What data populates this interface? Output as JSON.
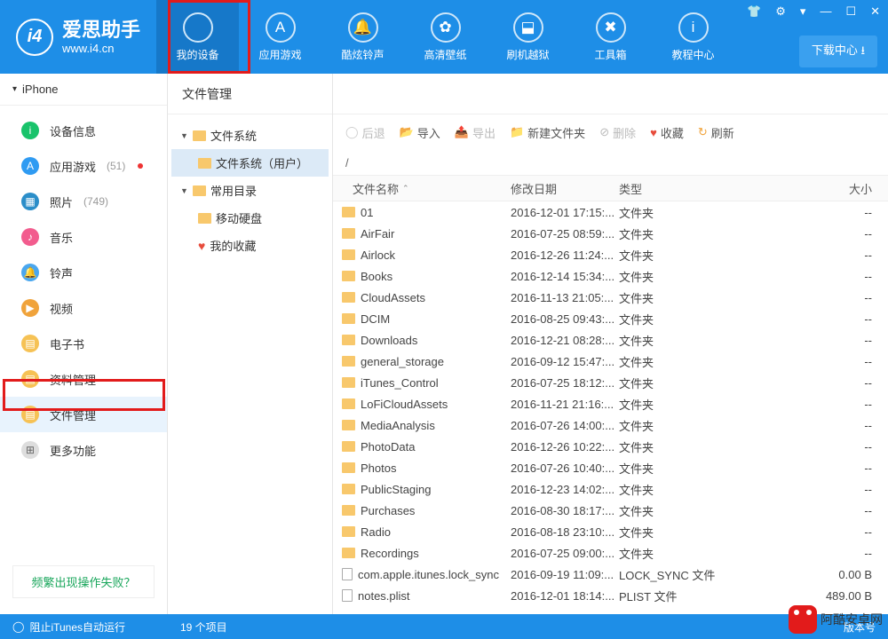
{
  "brand": {
    "title": "爱思助手",
    "url": "www.i4.cn",
    "logo_text": "i4"
  },
  "nav": [
    {
      "label": "我的设备",
      "icon": "apple-icon",
      "glyph": ""
    },
    {
      "label": "应用游戏",
      "icon": "apps-icon",
      "glyph": "A"
    },
    {
      "label": "酷炫铃声",
      "icon": "bell-icon",
      "glyph": "🔔"
    },
    {
      "label": "高清壁纸",
      "icon": "flower-icon",
      "glyph": "✿"
    },
    {
      "label": "刷机越狱",
      "icon": "box-icon",
      "glyph": "⬓"
    },
    {
      "label": "工具箱",
      "icon": "tools-icon",
      "glyph": "✖"
    },
    {
      "label": "教程中心",
      "icon": "info-icon",
      "glyph": "i"
    }
  ],
  "download_center": "下载中心 ⭳",
  "window_controls": [
    "👕",
    "⚙",
    "▾",
    "—",
    "☐",
    "✕"
  ],
  "device_name": "iPhone",
  "sidebar": [
    {
      "label": "设备信息",
      "count": "",
      "color": "ico-green",
      "glyph": "i"
    },
    {
      "label": "应用游戏",
      "count": "(51)",
      "dot": true,
      "color": "ico-blue",
      "glyph": "A"
    },
    {
      "label": "照片",
      "count": "(749)",
      "color": "ico-teal",
      "glyph": "▦"
    },
    {
      "label": "音乐",
      "count": "",
      "color": "ico-pink",
      "glyph": "♪"
    },
    {
      "label": "铃声",
      "count": "",
      "color": "ico-lblue",
      "glyph": "🔔"
    },
    {
      "label": "视频",
      "count": "",
      "color": "ico-orange",
      "glyph": "▶"
    },
    {
      "label": "电子书",
      "count": "",
      "color": "ico-yel",
      "glyph": "▤"
    },
    {
      "label": "资料管理",
      "count": "",
      "color": "ico-yel",
      "glyph": "▤"
    },
    {
      "label": "文件管理",
      "count": "",
      "color": "ico-yel2",
      "glyph": "▤",
      "selected": true
    },
    {
      "label": "更多功能",
      "count": "",
      "color": "",
      "glyph": "⊞"
    }
  ],
  "sidebar_help": "频繁出现操作失败？",
  "tab_label": "文件管理",
  "toolbar": {
    "back": "后退",
    "import": "导入",
    "export": "导出",
    "new_folder": "新建文件夹",
    "delete": "删除",
    "favorite": "收藏",
    "refresh": "刷新"
  },
  "tree": {
    "root1": "文件系统",
    "root1_child": "文件系统（用户）",
    "root2": "常用目录",
    "root2_child1": "移动硬盘",
    "root2_child2": "我的收藏"
  },
  "path": "/",
  "columns": {
    "name": "文件名称",
    "date": "修改日期",
    "type": "类型",
    "size": "大小"
  },
  "files": [
    {
      "name": "01",
      "date": "2016-12-01 17:15:...",
      "type": "文件夹",
      "size": "--",
      "kind": "folder"
    },
    {
      "name": "AirFair",
      "date": "2016-07-25 08:59:...",
      "type": "文件夹",
      "size": "--",
      "kind": "folder"
    },
    {
      "name": "Airlock",
      "date": "2016-12-26 11:24:...",
      "type": "文件夹",
      "size": "--",
      "kind": "folder"
    },
    {
      "name": "Books",
      "date": "2016-12-14 15:34:...",
      "type": "文件夹",
      "size": "--",
      "kind": "folder"
    },
    {
      "name": "CloudAssets",
      "date": "2016-11-13 21:05:...",
      "type": "文件夹",
      "size": "--",
      "kind": "folder"
    },
    {
      "name": "DCIM",
      "date": "2016-08-25 09:43:...",
      "type": "文件夹",
      "size": "--",
      "kind": "folder"
    },
    {
      "name": "Downloads",
      "date": "2016-12-21 08:28:...",
      "type": "文件夹",
      "size": "--",
      "kind": "folder"
    },
    {
      "name": "general_storage",
      "date": "2016-09-12 15:47:...",
      "type": "文件夹",
      "size": "--",
      "kind": "folder"
    },
    {
      "name": "iTunes_Control",
      "date": "2016-07-25 18:12:...",
      "type": "文件夹",
      "size": "--",
      "kind": "folder"
    },
    {
      "name": "LoFiCloudAssets",
      "date": "2016-11-21 21:16:...",
      "type": "文件夹",
      "size": "--",
      "kind": "folder"
    },
    {
      "name": "MediaAnalysis",
      "date": "2016-07-26 14:00:...",
      "type": "文件夹",
      "size": "--",
      "kind": "folder"
    },
    {
      "name": "PhotoData",
      "date": "2016-12-26 10:22:...",
      "type": "文件夹",
      "size": "--",
      "kind": "folder"
    },
    {
      "name": "Photos",
      "date": "2016-07-26 10:40:...",
      "type": "文件夹",
      "size": "--",
      "kind": "folder"
    },
    {
      "name": "PublicStaging",
      "date": "2016-12-23 14:02:...",
      "type": "文件夹",
      "size": "--",
      "kind": "folder"
    },
    {
      "name": "Purchases",
      "date": "2016-08-30 18:17:...",
      "type": "文件夹",
      "size": "--",
      "kind": "folder"
    },
    {
      "name": "Radio",
      "date": "2016-08-18 23:10:...",
      "type": "文件夹",
      "size": "--",
      "kind": "folder"
    },
    {
      "name": "Recordings",
      "date": "2016-07-25 09:00:...",
      "type": "文件夹",
      "size": "--",
      "kind": "folder"
    },
    {
      "name": "com.apple.itunes.lock_sync",
      "date": "2016-09-19 11:09:...",
      "type": "LOCK_SYNC 文件",
      "size": "0.00 B",
      "kind": "file"
    },
    {
      "name": "notes.plist",
      "date": "2016-12-01 18:14:...",
      "type": "PLIST 文件",
      "size": "489.00 B",
      "kind": "file"
    }
  ],
  "status": {
    "itunes": "阻止iTunes自动运行",
    "items": "19 个项目",
    "version": "版本号"
  },
  "watermark": "阿酷安卓网"
}
